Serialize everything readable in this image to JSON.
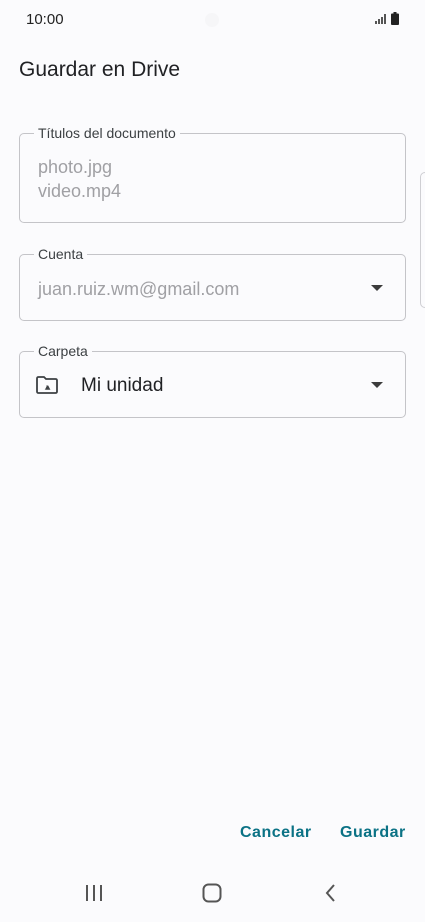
{
  "status_bar": {
    "time": "10:00",
    "signal_icon": "signal-icon",
    "battery_icon": "battery-icon"
  },
  "dialog": {
    "title": "Guardar en Drive",
    "documents": {
      "label": "Títulos del documento",
      "items": [
        "photo.jpg",
        "video.mp4"
      ]
    },
    "account": {
      "label": "Cuenta",
      "value": "juan.ruiz.wm@gmail.com",
      "icon": "chevron-down-icon"
    },
    "folder": {
      "label": "Carpeta",
      "value": "Mi unidad",
      "icon": "shared-drive-folder-icon"
    },
    "actions": {
      "cancel": "Cancelar",
      "save": "Guardar"
    }
  },
  "nav_bar": {
    "recents_icon": "recents-icon",
    "home_icon": "home-icon",
    "back_icon": "back-icon"
  },
  "colors": {
    "accent": "#0b7285",
    "background": "#fbfbfd",
    "outline": "#c4c4c8",
    "placeholder_text": "#a0a0a4"
  }
}
